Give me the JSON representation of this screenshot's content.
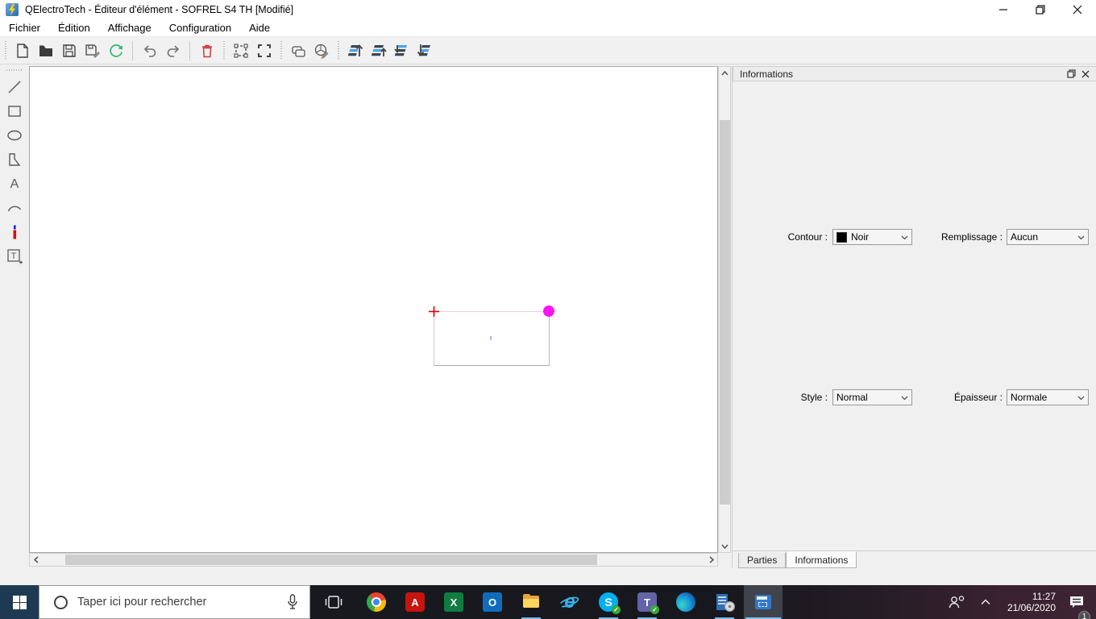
{
  "window": {
    "title": "QElectroTech - Éditeur d'élément - SOFREL S4 TH [Modifié]",
    "control_icons": [
      "minimize-icon",
      "restore-icon",
      "close-icon"
    ]
  },
  "menubar": {
    "items": [
      "Fichier",
      "Édition",
      "Affichage",
      "Configuration",
      "Aide"
    ]
  },
  "toolbar": {
    "icons": [
      "new-document-icon",
      "open-folder-icon",
      "save-icon",
      "save-as-icon",
      "reload-icon",
      "undo-icon",
      "redo-icon",
      "delete-icon",
      "edit-selection-icon",
      "end-selection-icon",
      "notes-icon",
      "color-pencil-icon",
      "bring-forward-icon",
      "raise-icon",
      "lower-icon",
      "send-backward-icon"
    ],
    "accent_colors": {
      "reload": "#2eb872",
      "delete": "#cc3b3b",
      "layer_blue": "#4aa3e8"
    }
  },
  "palette": {
    "icons": [
      "line-tool-icon",
      "rectangle-tool-icon",
      "ellipse-tool-icon",
      "polygon-tool-icon",
      "text-tool-icon",
      "arc-tool-icon",
      "terminal-tool-icon",
      "textfield-tool-icon"
    ]
  },
  "canvas": {
    "origin_marker_color": "#e00000",
    "selection_handle_color": "#ff14f0",
    "rect_border_color": "#e5bfcc"
  },
  "dock": {
    "title": "Informations",
    "fields": [
      {
        "label": "Contour :",
        "value": "Noir",
        "swatch": "#000000"
      },
      {
        "label": "Remplissage :",
        "value": "Aucun"
      },
      {
        "label": "Style :",
        "value": "Normal"
      },
      {
        "label": "Épaisseur :",
        "value": "Normale"
      }
    ],
    "tabs": [
      {
        "label": "Parties",
        "active": false
      },
      {
        "label": "Informations",
        "active": true
      }
    ]
  },
  "taskbar": {
    "search_placeholder": "Taper ici pour rechercher",
    "icons": [
      "start-icon",
      "search-icon",
      "microphone-icon",
      "task-view-icon",
      "chrome-icon",
      "acrobat-icon",
      "excel-icon",
      "outlook-icon",
      "file-explorer-icon",
      "internet-explorer-icon",
      "skype-icon",
      "teams-icon",
      "edge-icon",
      "software-center-icon",
      "qelectrotech-icon"
    ],
    "icon_letters": {
      "acrobat": "A",
      "excel": "X",
      "outlook": "O",
      "ie": "e",
      "skype": "S",
      "teams": "T",
      "check": "✓"
    },
    "tray": {
      "time": "11:27",
      "date": "21/06/2020",
      "notification_count": "1"
    }
  }
}
